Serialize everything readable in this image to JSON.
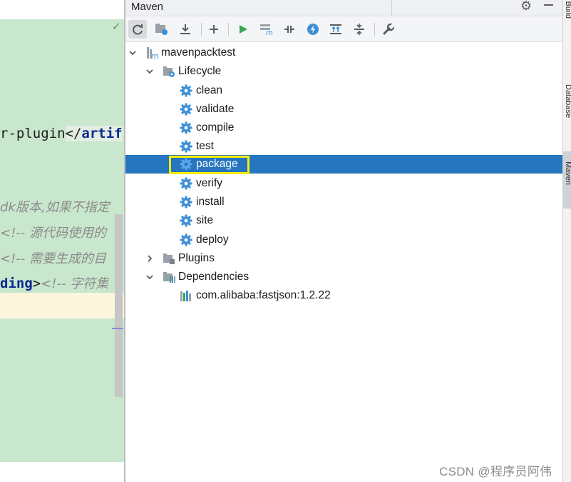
{
  "editor": {
    "line1_text": "r-plugin",
    "line1_tag": "</",
    "line1_kw": "artif",
    "line2_comment": "dk版本,如果不指定",
    "line3_comment": "<!-- 源代码使用的",
    "line4_comment": "<!-- 需要生成的目",
    "line5_kw": "ding",
    "line5_tag": ">",
    "line5_comment": "<!-- 字符集"
  },
  "maven": {
    "title": "Maven",
    "toolbar": [
      {
        "name": "reload-icon",
        "glyph": "⟳"
      },
      {
        "name": "generate-sources-icon",
        "glyph": "▤"
      },
      {
        "name": "download-icon",
        "glyph": "⤓"
      },
      {
        "name": "add-icon",
        "glyph": "+"
      },
      {
        "name": "run-icon",
        "glyph": "▶"
      },
      {
        "name": "execute-goal-icon",
        "glyph": "m"
      },
      {
        "name": "toggle-offline-icon",
        "glyph": "⫲"
      },
      {
        "name": "skip-tests-icon",
        "glyph": "⚡"
      },
      {
        "name": "show-dependencies-icon",
        "glyph": "⇈"
      },
      {
        "name": "collapse-all-icon",
        "glyph": "⇕"
      },
      {
        "name": "settings-wrench-icon",
        "glyph": "🔧"
      }
    ],
    "tree": {
      "project": "mavenpacktest",
      "lifecycle": {
        "label": "Lifecycle",
        "items": [
          "clean",
          "validate",
          "compile",
          "test",
          "package",
          "verify",
          "install",
          "site",
          "deploy"
        ],
        "selected": "package"
      },
      "plugins": "Plugins",
      "dependencies": {
        "label": "Dependencies",
        "items": [
          "com.alibaba:fastjson:1.2.22"
        ]
      }
    }
  },
  "side_strip": {
    "tabs": [
      "Ant Build",
      "Database",
      "Maven"
    ],
    "active": "Maven"
  },
  "watermark": "CSDN @程序员阿伟",
  "colors": {
    "selection": "#2675bf",
    "highlight_box": "#f5ee0a",
    "editor_green": "#c8e7cc",
    "goal_icon": "#3d8fd6"
  }
}
